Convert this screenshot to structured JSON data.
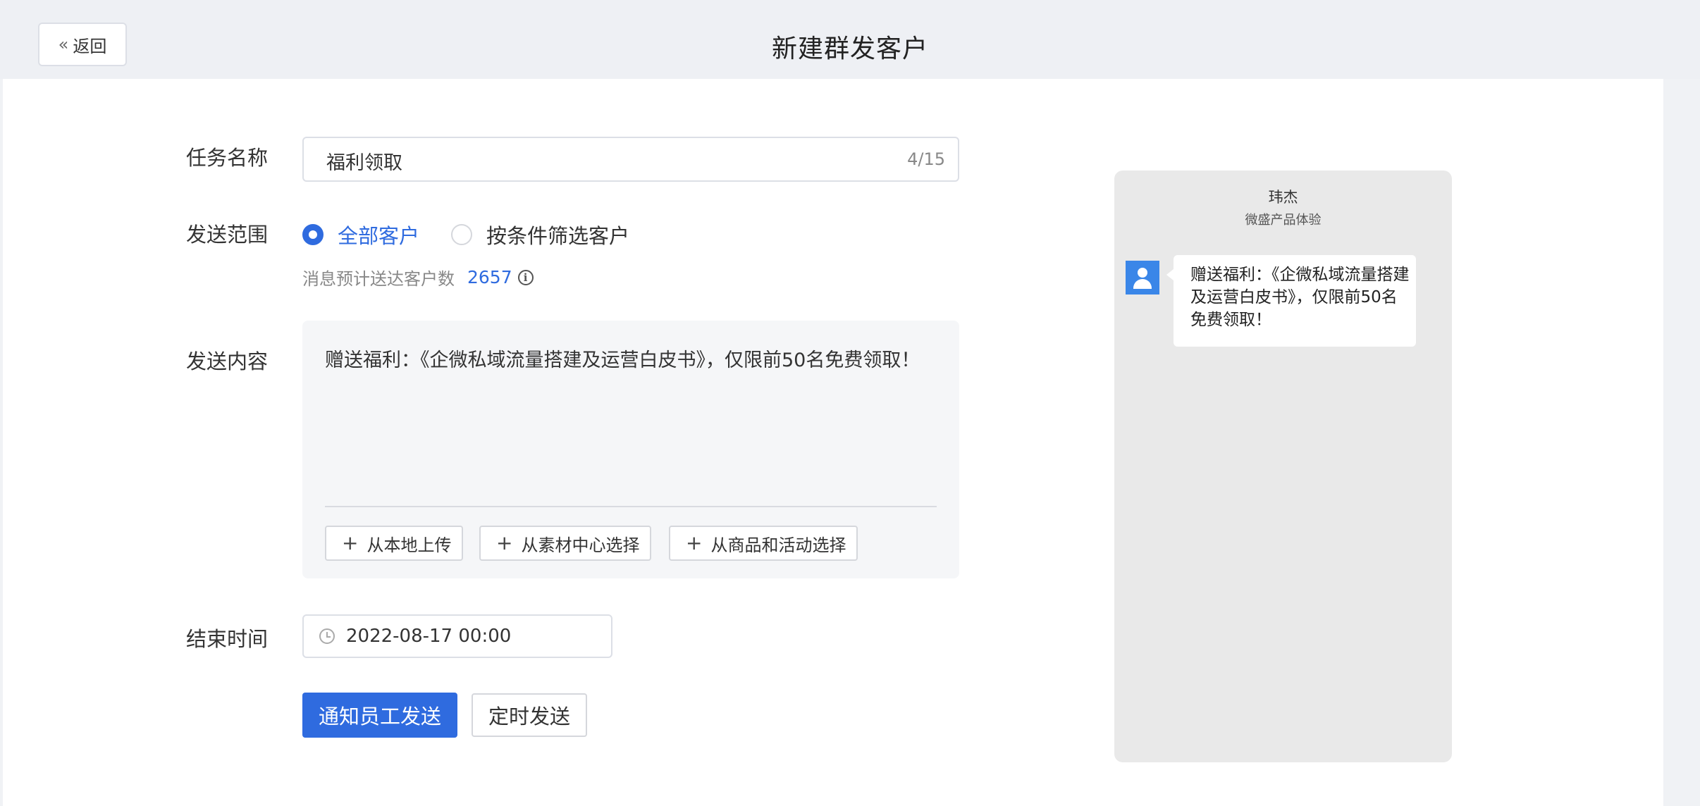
{
  "header": {
    "back_label": "返回",
    "title": "新建群发客户"
  },
  "form": {
    "task_name": {
      "label": "任务名称",
      "value": "福利领取",
      "counter": "4/15"
    },
    "scope": {
      "label": "发送范围",
      "options": [
        {
          "label": "全部客户",
          "selected": true
        },
        {
          "label": "按条件筛选客户",
          "selected": false
        }
      ],
      "estimate_label": "消息预计送达客户数",
      "estimate_count": "2657"
    },
    "content": {
      "label": "发送内容",
      "text": "赠送福利：《企微私域流量搭建及运营白皮书》，仅限前50名免费领取！",
      "buttons": [
        "从本地上传",
        "从素材中心选择",
        "从商品和活动选择"
      ]
    },
    "end_time": {
      "label": "结束时间",
      "value": "2022-08-17 00:00"
    },
    "actions": {
      "primary": "通知员工发送",
      "secondary": "定时发送"
    }
  },
  "preview": {
    "sender_name": "玮杰",
    "sender_sub": "微盛产品体验",
    "message": "赠送福利：《企微私域流量搭建及运营白皮书》，仅限前50名免费领取！"
  },
  "colors": {
    "accent": "#2f6bdf",
    "avatar": "#3a86e8"
  }
}
